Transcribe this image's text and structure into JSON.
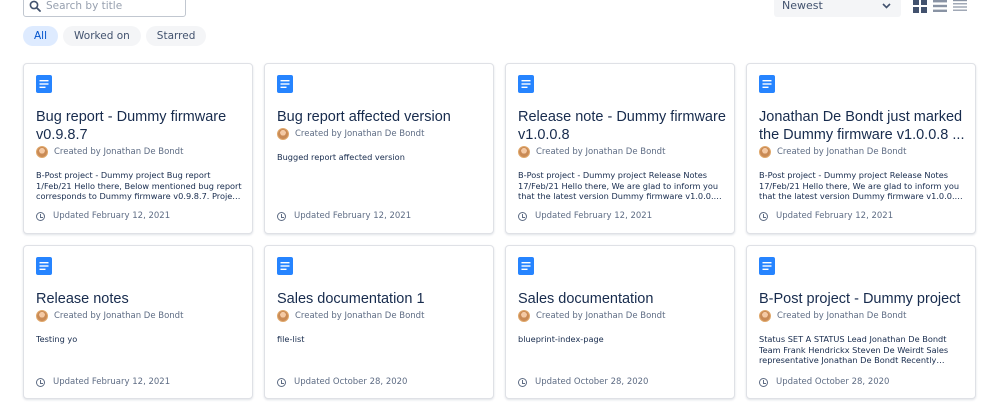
{
  "search": {
    "placeholder": "Search by title",
    "value": ""
  },
  "sort": {
    "selected": "Newest"
  },
  "view_modes": [
    "grid",
    "compact-list",
    "list"
  ],
  "filters": [
    {
      "label": "All",
      "active": true
    },
    {
      "label": "Worked on",
      "active": false
    },
    {
      "label": "Starred",
      "active": false
    }
  ],
  "colors": {
    "accent": "#0052cc",
    "doc_icon": "#2684ff",
    "pill_active_bg": "#deebff"
  },
  "cards": [
    {
      "title": "Bug report - Dummy firmware v0.9.8.7",
      "author": "Created by Jonathan De Bondt",
      "excerpt": "B-Post project - Dummy project Bug report 1/Feb/21 Hello there, Below mentioned bug report corresponds to Dummy firmware v0.9.8.7. Project -...",
      "updated": "Updated February 12, 2021"
    },
    {
      "title": "Bug report affected version",
      "author": "Created by Jonathan De Bondt",
      "excerpt": "Bugged report affected version",
      "updated": "Updated February 12, 2021"
    },
    {
      "title": "Release note - Dummy firmware v1.0.0.8",
      "author": "Created by Jonathan De Bondt",
      "excerpt": "B-Post project - Dummy project Release Notes 17/Feb/21 Hello there, We are glad to inform you that the latest version Dummy firmware v1.0.0.8 of...",
      "updated": "Updated February 12, 2021"
    },
    {
      "title": "Jonathan De Bondt just marked the Dummy firmware v1.0.0.8 ...",
      "author": "Created by Jonathan De Bondt",
      "excerpt": "B-Post project - Dummy project Release Notes 17/Feb/21 Hello there, We are glad to inform you that the latest version Dummy firmware v1.0.0.8 of...",
      "updated": "Updated February 12, 2021"
    },
    {
      "title": "Release notes",
      "author": "Created by Jonathan De Bondt",
      "excerpt": "Testing yo",
      "updated": "Updated February 12, 2021"
    },
    {
      "title": "Sales documentation 1",
      "author": "Created by Jonathan De Bondt",
      "excerpt": "file-list",
      "updated": "Updated October 28, 2020"
    },
    {
      "title": "Sales documentation",
      "author": "Created by Jonathan De Bondt",
      "excerpt": "blueprint-index-page",
      "updated": "Updated October 28, 2020"
    },
    {
      "title": "B-Post project - Dummy project",
      "author": "Created by Jonathan De Bondt",
      "excerpt": "Status SET A STATUS Lead Jonathan De Bondt Team Frank Hendrickx Steven De Weirdt Sales representative Jonathan De Bondt Recently updated...",
      "updated": "Updated October 28, 2020"
    }
  ]
}
